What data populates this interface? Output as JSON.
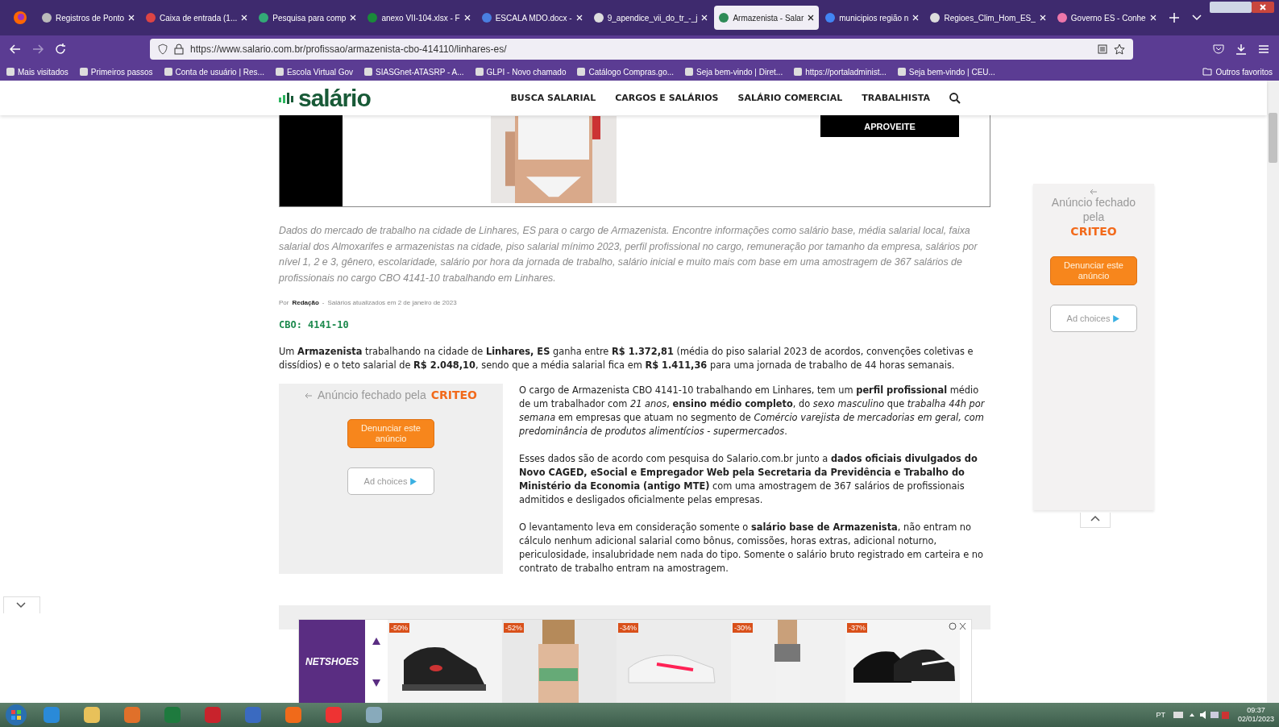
{
  "browser": {
    "tabs": [
      {
        "title": "Registros de Ponto",
        "selected": false
      },
      {
        "title": "Caixa de entrada (1...",
        "selected": false
      },
      {
        "title": "Pesquisa para comp",
        "selected": false
      },
      {
        "title": "anexo VII-104.xlsx - F",
        "selected": false
      },
      {
        "title": "ESCALA MDO.docx -",
        "selected": false
      },
      {
        "title": "9_apendice_vii_do_tr_-_j",
        "selected": false
      },
      {
        "title": "Armazenista - Salar",
        "selected": true
      },
      {
        "title": "municipios região n",
        "selected": false
      },
      {
        "title": "Regioes_Clim_Hom_ES_",
        "selected": false
      },
      {
        "title": "Governo ES - Conhe",
        "selected": false
      }
    ],
    "url": "https://www.salario.com.br/profissao/armazenista-cbo-414110/linhares-es/",
    "bookmarks": [
      "Mais visitados",
      "Primeiros passos",
      "Conta de usuário | Res...",
      "Escola Virtual Gov",
      "SIASGnet-ATASRP - A...",
      "GLPI - Novo chamado",
      "Catálogo Compras.go...",
      "Seja bem-vindo | Diret...",
      "https://portaladminist...",
      "Seja bem-vindo | CEU..."
    ],
    "other_bookmarks": "Outros favoritos"
  },
  "site": {
    "logo": "salário",
    "nav": [
      "BUSCA SALARIAL",
      "CARGOS E SALÁRIOS",
      "SALÁRIO COMERCIAL",
      "TRABALHISTA"
    ]
  },
  "top_ad": {
    "button": "APROVEITE"
  },
  "intro": "Dados do mercado de trabalho na cidade de Linhares, ES para o cargo de Armazenista. Encontre informações como salário base, média salarial local, faixa salarial dos Almoxarifes e armazenistas na cidade, piso salarial mínimo 2023, perfil profissional no cargo, remuneração por tamanho da empresa, salários por nível 1, 2 e 3, gênero, escolaridade, salário por hora da jornada de trabalho, salário inicial e muito mais com base em uma amostragem de 367 salários de profissionais no cargo CBO 4141-10 trabalhando em Linhares.",
  "byline": {
    "prefix": "Por",
    "author": "Redação",
    "separator": "-",
    "updated": "Salários atualizados em 2 de janeiro de 2023"
  },
  "cbo": "CBO: 4141-10",
  "summary": "Um **Armazenista** trabalhando na cidade de **Linhares, ES** ganha entre **R$ 1.372,81** (média do piso salarial 2023 de acordos, convenções coletivas e dissídios) e o teto salarial de **R$ 2.048,10**, sendo que a média salarial fica em **R$ 1.411,36** para uma jornada de trabalho de 44 horas semanais.",
  "inline_ad": {
    "closed_text": "Anúncio fechado pela",
    "brand": "CRITEO",
    "report_button": "Denunciar este anúncio",
    "ad_choices": "Ad choices"
  },
  "paragraphs": [
    "O cargo de Armazenista CBO 4141-10 trabalhando em Linhares, tem um **perfil profissional** médio de um trabalhador com *21 anos*, **ensino médio completo**, do *sexo masculino* que *trabalha 44h por semana* em empresas que atuam no segmento de *Comércio varejista de mercadorias em geral, com predominância de produtos alimentícios - supermercados*.",
    "Esses dados são de acordo com pesquisa do Salario.com.br junto a **dados oficiais divulgados do Novo CAGED, eSocial e Empregador Web pela Secretaria da Previdência e Trabalho do Ministério da Economia (antigo MTE)** com uma amostragem de 367 salários de profissionais admitidos e desligados oficialmente pelas empresas.",
    "O levantamento leva em consideração somente o **salário base de Armazenista**, não entram no cálculo nenhum adicional salarial como bônus, comissões, horas extras, adicional noturno, periculosidade, insalubridade nem nada do tipo. Somente o salário bruto registrado em carteira e no contrato de trabalho entram na amostragem."
  ],
  "side_ad": {
    "closed_text": "Anúncio fechado pela",
    "brand": "CRITEO",
    "report_button": "Denunciar este anúncio",
    "ad_choices": "Ad choices"
  },
  "bottom_ad": {
    "brand": "NETSHOES",
    "badges": [
      "-50%",
      "-52%",
      "-34%",
      "-30%",
      "-37%"
    ]
  },
  "taskbar": {
    "language": "PT",
    "time": "09:37",
    "date": "02/01/2023"
  }
}
